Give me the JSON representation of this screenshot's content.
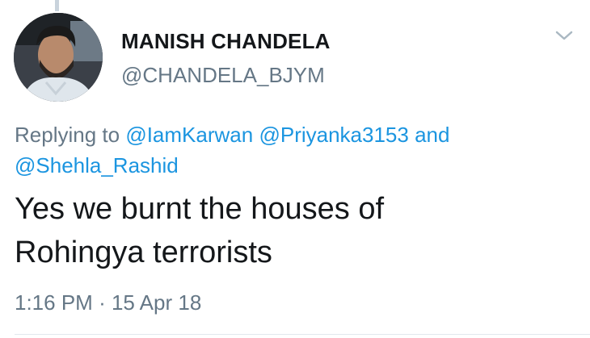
{
  "tweet": {
    "author_name": "MANISH CHANDELA",
    "author_handle": "@CHANDELA_BJYM",
    "replying_prefix": "Replying to",
    "mentions": [
      "@IamKarwan",
      "@Priyanka3153",
      "@Shehla_Rashid"
    ],
    "mentions_joiner": "and",
    "text_line1": "Yes we burnt the houses of",
    "text_line2": "Rohingya terrorists",
    "time": "1:16 PM",
    "separator": "·",
    "date": "15 Apr 18"
  },
  "icons": {
    "menu": "chevron-down-icon",
    "avatar": "avatar"
  },
  "colors": {
    "text_primary": "#14171a",
    "text_secondary": "#657786",
    "link": "#1b95e0",
    "divider": "#e1e8ed"
  }
}
